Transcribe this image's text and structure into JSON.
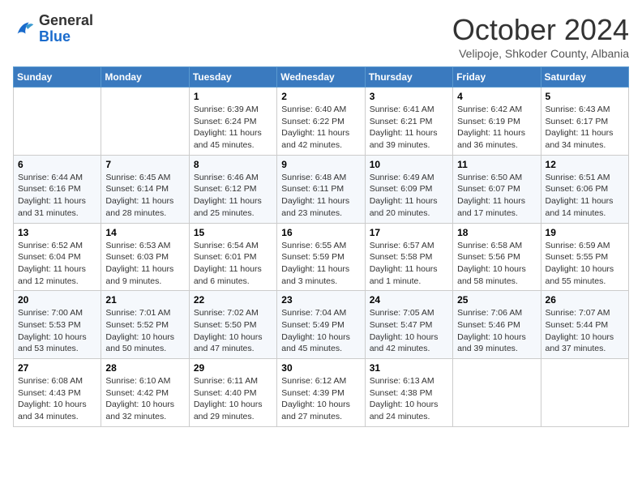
{
  "logo": {
    "general": "General",
    "blue": "Blue"
  },
  "header": {
    "month": "October 2024",
    "location": "Velipoje, Shkoder County, Albania"
  },
  "weekdays": [
    "Sunday",
    "Monday",
    "Tuesday",
    "Wednesday",
    "Thursday",
    "Friday",
    "Saturday"
  ],
  "weeks": [
    [
      {
        "day": "",
        "info": ""
      },
      {
        "day": "",
        "info": ""
      },
      {
        "day": "1",
        "info": "Sunrise: 6:39 AM\nSunset: 6:24 PM\nDaylight: 11 hours and 45 minutes."
      },
      {
        "day": "2",
        "info": "Sunrise: 6:40 AM\nSunset: 6:22 PM\nDaylight: 11 hours and 42 minutes."
      },
      {
        "day": "3",
        "info": "Sunrise: 6:41 AM\nSunset: 6:21 PM\nDaylight: 11 hours and 39 minutes."
      },
      {
        "day": "4",
        "info": "Sunrise: 6:42 AM\nSunset: 6:19 PM\nDaylight: 11 hours and 36 minutes."
      },
      {
        "day": "5",
        "info": "Sunrise: 6:43 AM\nSunset: 6:17 PM\nDaylight: 11 hours and 34 minutes."
      }
    ],
    [
      {
        "day": "6",
        "info": "Sunrise: 6:44 AM\nSunset: 6:16 PM\nDaylight: 11 hours and 31 minutes."
      },
      {
        "day": "7",
        "info": "Sunrise: 6:45 AM\nSunset: 6:14 PM\nDaylight: 11 hours and 28 minutes."
      },
      {
        "day": "8",
        "info": "Sunrise: 6:46 AM\nSunset: 6:12 PM\nDaylight: 11 hours and 25 minutes."
      },
      {
        "day": "9",
        "info": "Sunrise: 6:48 AM\nSunset: 6:11 PM\nDaylight: 11 hours and 23 minutes."
      },
      {
        "day": "10",
        "info": "Sunrise: 6:49 AM\nSunset: 6:09 PM\nDaylight: 11 hours and 20 minutes."
      },
      {
        "day": "11",
        "info": "Sunrise: 6:50 AM\nSunset: 6:07 PM\nDaylight: 11 hours and 17 minutes."
      },
      {
        "day": "12",
        "info": "Sunrise: 6:51 AM\nSunset: 6:06 PM\nDaylight: 11 hours and 14 minutes."
      }
    ],
    [
      {
        "day": "13",
        "info": "Sunrise: 6:52 AM\nSunset: 6:04 PM\nDaylight: 11 hours and 12 minutes."
      },
      {
        "day": "14",
        "info": "Sunrise: 6:53 AM\nSunset: 6:03 PM\nDaylight: 11 hours and 9 minutes."
      },
      {
        "day": "15",
        "info": "Sunrise: 6:54 AM\nSunset: 6:01 PM\nDaylight: 11 hours and 6 minutes."
      },
      {
        "day": "16",
        "info": "Sunrise: 6:55 AM\nSunset: 5:59 PM\nDaylight: 11 hours and 3 minutes."
      },
      {
        "day": "17",
        "info": "Sunrise: 6:57 AM\nSunset: 5:58 PM\nDaylight: 11 hours and 1 minute."
      },
      {
        "day": "18",
        "info": "Sunrise: 6:58 AM\nSunset: 5:56 PM\nDaylight: 10 hours and 58 minutes."
      },
      {
        "day": "19",
        "info": "Sunrise: 6:59 AM\nSunset: 5:55 PM\nDaylight: 10 hours and 55 minutes."
      }
    ],
    [
      {
        "day": "20",
        "info": "Sunrise: 7:00 AM\nSunset: 5:53 PM\nDaylight: 10 hours and 53 minutes."
      },
      {
        "day": "21",
        "info": "Sunrise: 7:01 AM\nSunset: 5:52 PM\nDaylight: 10 hours and 50 minutes."
      },
      {
        "day": "22",
        "info": "Sunrise: 7:02 AM\nSunset: 5:50 PM\nDaylight: 10 hours and 47 minutes."
      },
      {
        "day": "23",
        "info": "Sunrise: 7:04 AM\nSunset: 5:49 PM\nDaylight: 10 hours and 45 minutes."
      },
      {
        "day": "24",
        "info": "Sunrise: 7:05 AM\nSunset: 5:47 PM\nDaylight: 10 hours and 42 minutes."
      },
      {
        "day": "25",
        "info": "Sunrise: 7:06 AM\nSunset: 5:46 PM\nDaylight: 10 hours and 39 minutes."
      },
      {
        "day": "26",
        "info": "Sunrise: 7:07 AM\nSunset: 5:44 PM\nDaylight: 10 hours and 37 minutes."
      }
    ],
    [
      {
        "day": "27",
        "info": "Sunrise: 6:08 AM\nSunset: 4:43 PM\nDaylight: 10 hours and 34 minutes."
      },
      {
        "day": "28",
        "info": "Sunrise: 6:10 AM\nSunset: 4:42 PM\nDaylight: 10 hours and 32 minutes."
      },
      {
        "day": "29",
        "info": "Sunrise: 6:11 AM\nSunset: 4:40 PM\nDaylight: 10 hours and 29 minutes."
      },
      {
        "day": "30",
        "info": "Sunrise: 6:12 AM\nSunset: 4:39 PM\nDaylight: 10 hours and 27 minutes."
      },
      {
        "day": "31",
        "info": "Sunrise: 6:13 AM\nSunset: 4:38 PM\nDaylight: 10 hours and 24 minutes."
      },
      {
        "day": "",
        "info": ""
      },
      {
        "day": "",
        "info": ""
      }
    ]
  ]
}
